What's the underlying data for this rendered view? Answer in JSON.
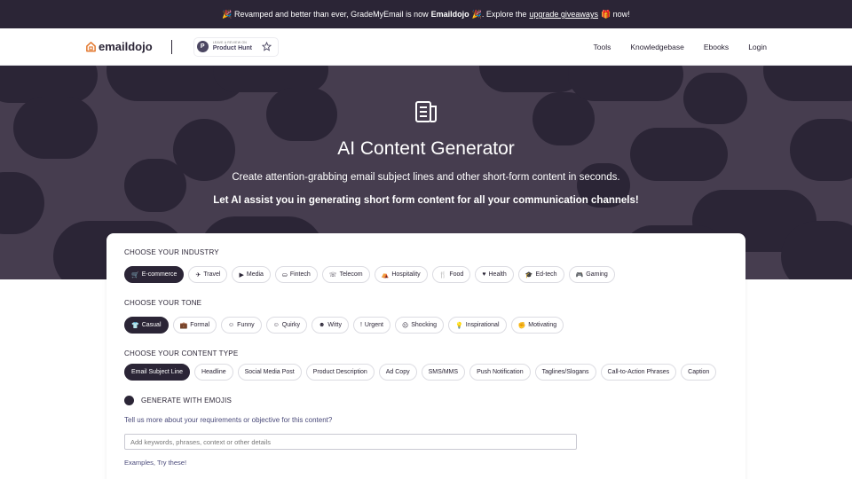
{
  "announcement": {
    "part1": "🎉 Revamped and better than ever, GradeMyEmail is now",
    "brand": "Emaildojo",
    "part2": "🎉. Explore the",
    "link": "upgrade giveaways",
    "part3": "🎁 now!"
  },
  "nav": {
    "logo_text": "emaildojo",
    "producthunt_small": "LEAVE A REVIEW ON",
    "producthunt_big": "Product Hunt",
    "producthunt_letter": "P",
    "links": [
      "Tools",
      "Knowledgebase",
      "Ebooks",
      "Login"
    ]
  },
  "hero": {
    "icon": "document-icon",
    "title": "AI Content Generator",
    "subtitle": "Create attention-grabbing email subject lines and other short-form content in seconds.",
    "subtitle2": "Let AI assist you in generating short form content for all your communication channels!"
  },
  "industry": {
    "title": "CHOOSE YOUR INDUSTRY",
    "options": [
      {
        "label": "E-commerce",
        "icon": "🛒",
        "selected": true
      },
      {
        "label": "Travel",
        "icon": "✈",
        "selected": false
      },
      {
        "label": "Media",
        "icon": "▶",
        "selected": false
      },
      {
        "label": "Fintech",
        "icon": "⛀",
        "selected": false
      },
      {
        "label": "Telecom",
        "icon": "☏",
        "selected": false
      },
      {
        "label": "Hospitality",
        "icon": "⛺",
        "selected": false
      },
      {
        "label": "Food",
        "icon": "🍴",
        "selected": false
      },
      {
        "label": "Health",
        "icon": "♥",
        "selected": false
      },
      {
        "label": "Ed-tech",
        "icon": "🎓",
        "selected": false
      },
      {
        "label": "Gaming",
        "icon": "🎮",
        "selected": false
      }
    ]
  },
  "tone": {
    "title": "CHOOSE YOUR TONE",
    "options": [
      {
        "label": "Casual",
        "icon": "👕",
        "selected": true
      },
      {
        "label": "Formal",
        "icon": "💼",
        "selected": false
      },
      {
        "label": "Funny",
        "icon": "☺",
        "selected": false
      },
      {
        "label": "Quirky",
        "icon": "☺",
        "selected": false
      },
      {
        "label": "Witty",
        "icon": "☻",
        "selected": false
      },
      {
        "label": "Urgent",
        "icon": "!",
        "selected": false
      },
      {
        "label": "Shocking",
        "icon": "☹",
        "selected": false
      },
      {
        "label": "Inspirational",
        "icon": "💡",
        "selected": false
      },
      {
        "label": "Motivating",
        "icon": "✊",
        "selected": false
      }
    ]
  },
  "content_type": {
    "title": "CHOOSE YOUR CONTENT TYPE",
    "options": [
      {
        "label": "Email Subject Line",
        "selected": true
      },
      {
        "label": "Headline",
        "selected": false
      },
      {
        "label": "Social Media Post",
        "selected": false
      },
      {
        "label": "Product Description",
        "selected": false
      },
      {
        "label": "Ad Copy",
        "selected": false
      },
      {
        "label": "SMS/MMS",
        "selected": false
      },
      {
        "label": "Push Notification",
        "selected": false
      },
      {
        "label": "Taglines/Slogans",
        "selected": false
      },
      {
        "label": "Call-to-Action Phrases",
        "selected": false
      },
      {
        "label": "Caption",
        "selected": false
      }
    ]
  },
  "emoji": {
    "label": "GENERATE WITH EMOJIS"
  },
  "requirements": {
    "question": "Tell us more about your requirements or objective for this content?",
    "placeholder": "Add keywords, phrases, context or other details",
    "value": ""
  },
  "examples_label": "Examples, Try these!",
  "colors": {
    "dark": "#2b2536",
    "hero_bg": "#463d4f",
    "hero_shape": "#2b2536",
    "link": "#4a4a7a"
  }
}
